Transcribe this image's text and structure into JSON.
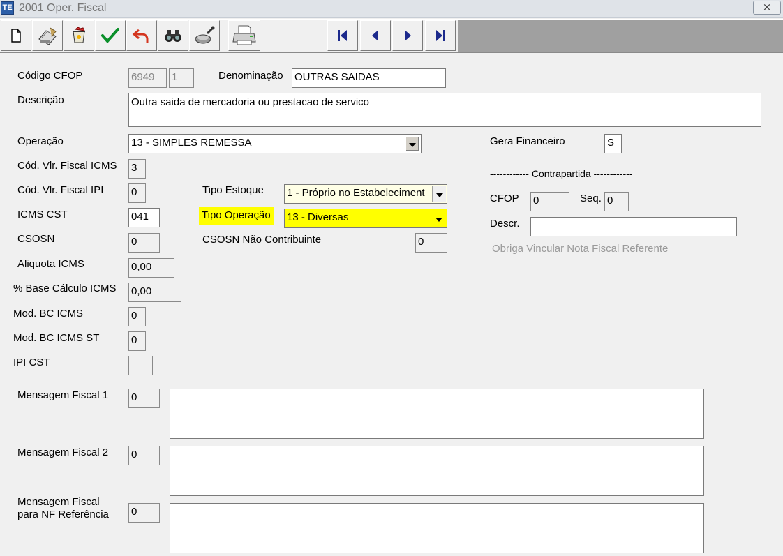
{
  "window": {
    "title": "2001 Oper. Fiscal",
    "app_icon_text": "TE",
    "close_glyph": "⨯"
  },
  "toolbar": {
    "buttons": [
      {
        "name": "new-icon"
      },
      {
        "name": "edit-icon"
      },
      {
        "name": "delete-icon"
      },
      {
        "name": "confirm-icon"
      },
      {
        "name": "undo-icon"
      },
      {
        "name": "search-icon"
      },
      {
        "name": "filter-icon"
      },
      {
        "name": "print-icon"
      }
    ],
    "nav": [
      {
        "name": "first-record-icon"
      },
      {
        "name": "prev-record-icon"
      },
      {
        "name": "next-record-icon"
      },
      {
        "name": "last-record-icon"
      }
    ]
  },
  "form": {
    "codigo_cfop": {
      "label": "Código CFOP",
      "value": "6949",
      "seq": "1"
    },
    "denominacao": {
      "label": "Denominação",
      "value": "OUTRAS SAIDAS"
    },
    "descricao": {
      "label": "Descrição",
      "value": "Outra saida de mercadoria ou prestacao de servico"
    },
    "operacao": {
      "label": "Operação",
      "value": "13 - SIMPLES REMESSA"
    },
    "cod_vlr_fiscal_icms": {
      "label": "Cód. Vlr. Fiscal ICMS",
      "value": "3"
    },
    "cod_vlr_fiscal_ipi": {
      "label": "Cód. Vlr. Fiscal IPI",
      "value": "0"
    },
    "icms_cst": {
      "label": "ICMS CST",
      "value": "041"
    },
    "csosn": {
      "label": "CSOSN",
      "value": "0"
    },
    "aliquota_icms": {
      "label": "Aliquota ICMS",
      "value": "0,00"
    },
    "base_calculo_icms": {
      "label": "% Base Cálculo ICMS",
      "value": "0,00"
    },
    "mod_bc_icms": {
      "label": "Mod. BC ICMS",
      "value": "0"
    },
    "mod_bc_icms_st": {
      "label": "Mod. BC ICMS ST",
      "value": "0"
    },
    "ipi_cst": {
      "label": "IPI CST",
      "value": ""
    },
    "tipo_estoque": {
      "label": "Tipo Estoque",
      "value": "1 - Próprio no Estabeleciment"
    },
    "tipo_operacao": {
      "label": "Tipo Operação",
      "value": "13 - Diversas"
    },
    "csosn_nao_contribuinte": {
      "label": "CSOSN Não Contribuinte",
      "value": "0"
    },
    "gera_financeiro": {
      "label": "Gera Financeiro",
      "value": "S"
    },
    "contrapartida": {
      "label": "------------  Contrapartida  ------------"
    },
    "cfop": {
      "label": "CFOP",
      "value": "0"
    },
    "seq": {
      "label": "Seq.",
      "value": "0"
    },
    "descr": {
      "label": "Descr.",
      "value": ""
    },
    "obriga_vincular": {
      "label": "Obriga Vincular Nota Fiscal Referente",
      "checked": false
    },
    "mensagem_fiscal_1": {
      "label": "Mensagem Fiscal 1",
      "code": "0",
      "text": ""
    },
    "mensagem_fiscal_2": {
      "label": "Mensagem Fiscal 2",
      "code": "0",
      "text": ""
    },
    "mensagem_fiscal_nf": {
      "label_line1": "Mensagem Fiscal",
      "label_line2": "para NF Referência",
      "code": "0",
      "text": ""
    }
  },
  "colors": {
    "highlight": "#ffff00",
    "background": "#f0f0f0",
    "toolbar_right": "#a0a0a0"
  }
}
